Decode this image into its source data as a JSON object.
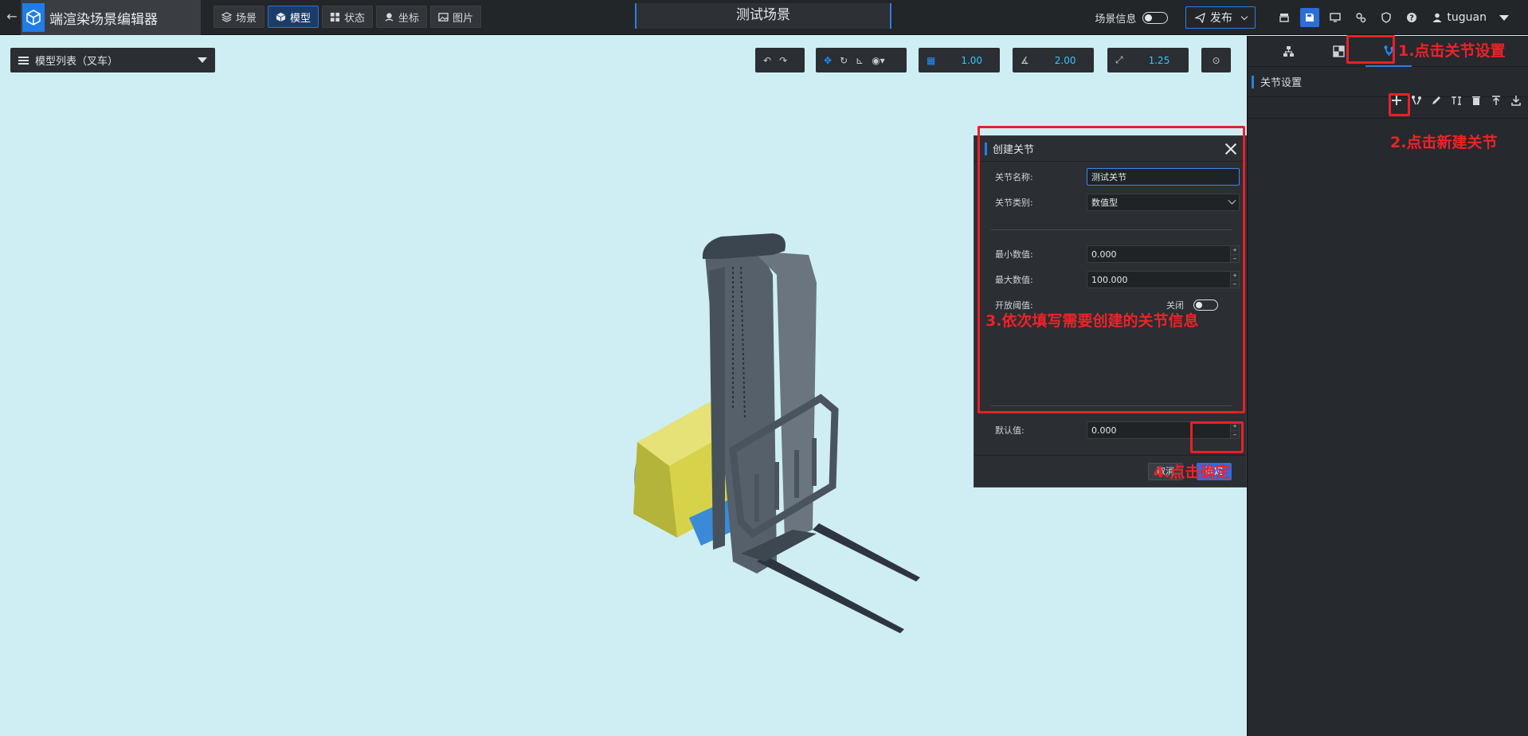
{
  "header": {
    "brand_title": "端渲染场景编辑器",
    "mode_tabs": [
      {
        "label": "场景",
        "icon": "layers-icon",
        "active": false
      },
      {
        "label": "模型",
        "icon": "cube-icon",
        "active": true
      },
      {
        "label": "状态",
        "icon": "grid-icon",
        "active": false
      },
      {
        "label": "坐标",
        "icon": "pin-icon",
        "active": false
      },
      {
        "label": "图片",
        "icon": "image-icon",
        "active": false
      }
    ],
    "scene_title": "测试场景",
    "scene_info_label": "场景信息",
    "publish_label": "发布",
    "username": "tuguan"
  },
  "viewport": {
    "model_list_label": "模型列表（叉车）",
    "grid_value": "1.00",
    "angle_value": "2.00",
    "scale_value": "1.25"
  },
  "dialog": {
    "title": "创建关节",
    "name_label": "关节名称:",
    "name_value": "测试关节",
    "type_label": "关节类别:",
    "type_value": "数值型",
    "min_label": "最小数值:",
    "min_value": "0.000",
    "max_label": "最大数值:",
    "max_value": "100.000",
    "threshold_label": "开放阈值:",
    "threshold_state": "关闭",
    "default_label": "默认值:",
    "default_value": "0.000",
    "cancel_label": "取消",
    "ok_label": "确定"
  },
  "right_panel": {
    "section_title": "关节设置"
  },
  "annotations": {
    "step1": "1.点击关节设置",
    "step2": "2.点击新建关节",
    "step3": "3.依次填写需要创建的关节信息",
    "step4": "4.点击确定"
  },
  "colors": {
    "accent": "#2f7de0",
    "annotation": "#e8202a",
    "viewport_bg": "#cfeef3",
    "panel_bg": "#26292d"
  }
}
